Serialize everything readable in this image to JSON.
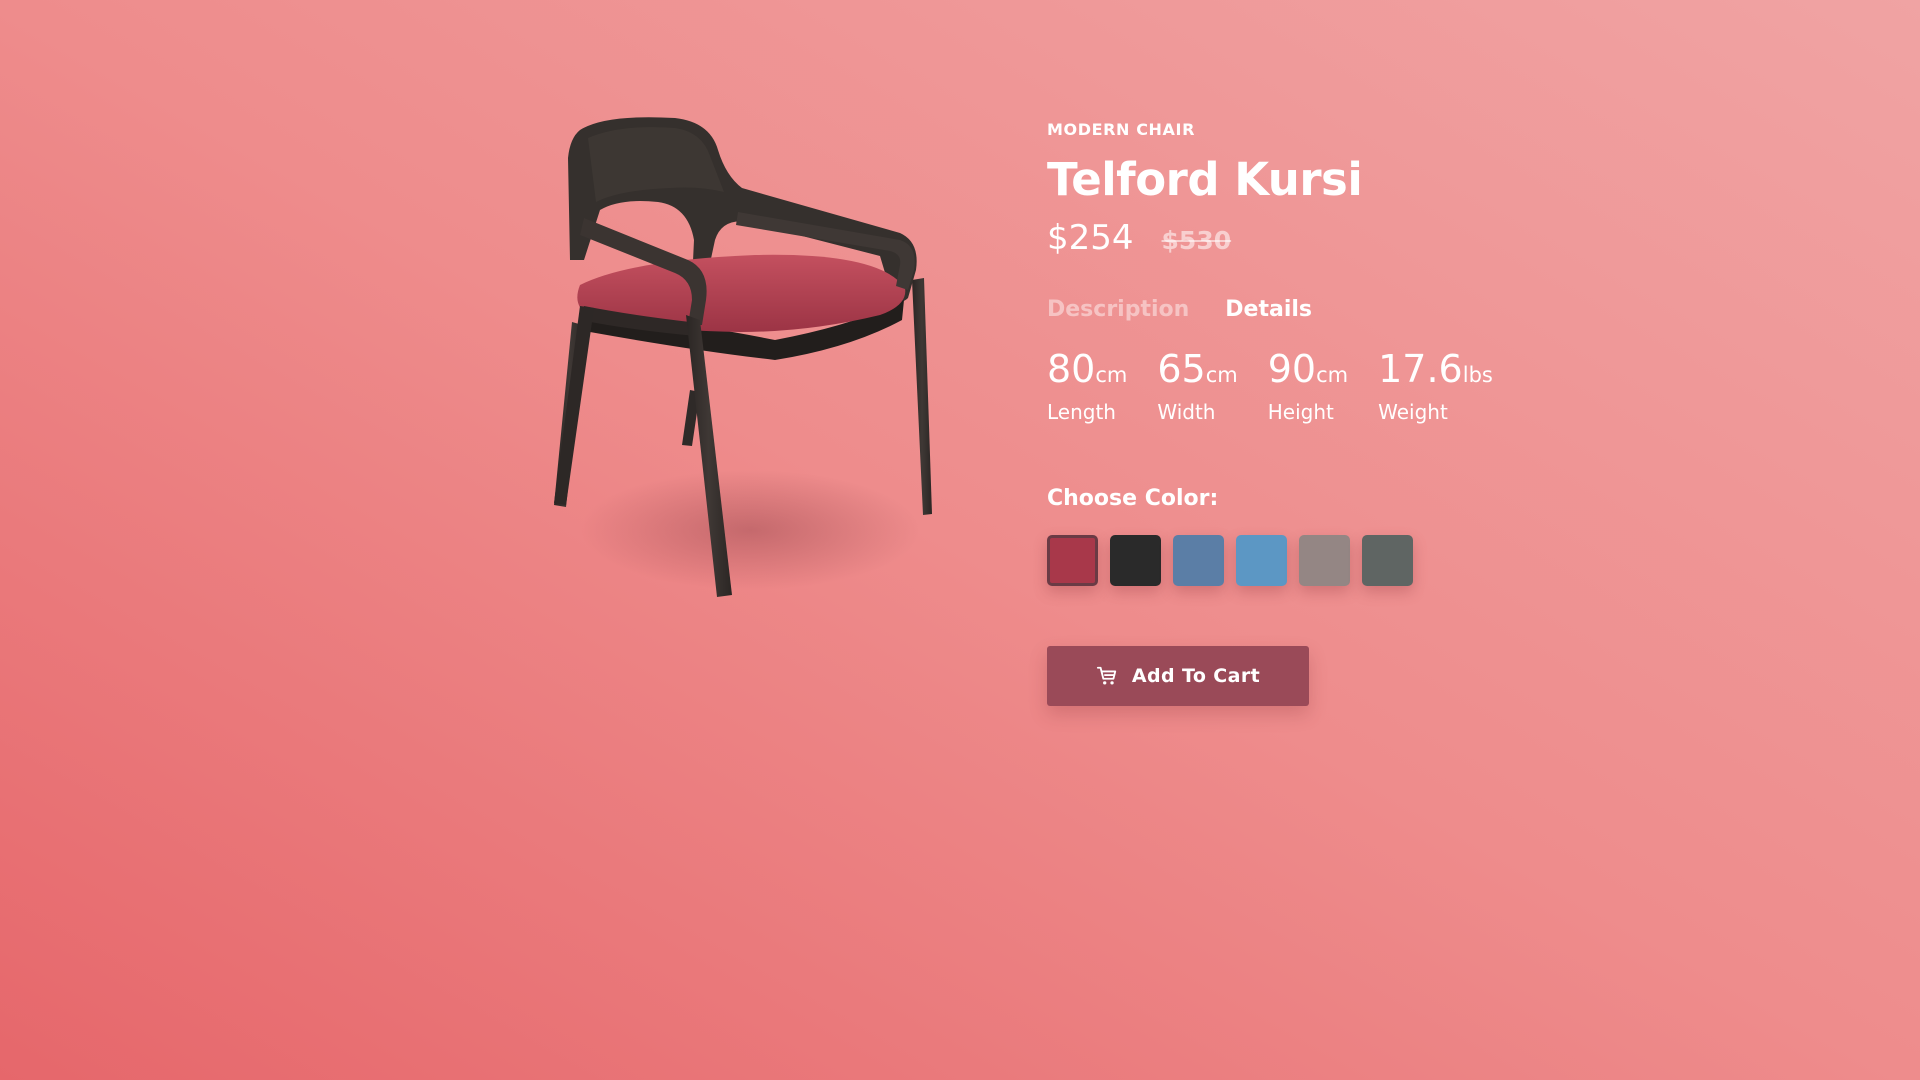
{
  "product": {
    "category": "MODERN CHAIR",
    "name": "Telford Kursi",
    "price": "$254",
    "old_price": "$530",
    "image_icon": "chair-image"
  },
  "tabs": [
    {
      "label": "Description",
      "active": false
    },
    {
      "label": "Details",
      "active": true
    }
  ],
  "specs": [
    {
      "value": "80",
      "unit": "cm",
      "label": "Length"
    },
    {
      "value": "65",
      "unit": "cm",
      "label": "Width"
    },
    {
      "value": "90",
      "unit": "cm",
      "label": "Height"
    },
    {
      "value": "17.6",
      "unit": "lbs",
      "label": "Weight"
    }
  ],
  "color_picker": {
    "heading": "Choose Color:",
    "selected_index": 0,
    "colors": [
      "#a8384a",
      "#2a2a2a",
      "#5b7ea6",
      "#5c97c4",
      "#948684",
      "#5f6563"
    ]
  },
  "cart": {
    "label": "Add To Cart",
    "icon": "cart-icon"
  },
  "theme": {
    "background_bottom": "#e6676b",
    "background_top": "#f0a3a3",
    "button": "#9a4a58",
    "chair_wood": "#35302d",
    "chair_seat": "#b8475a"
  }
}
